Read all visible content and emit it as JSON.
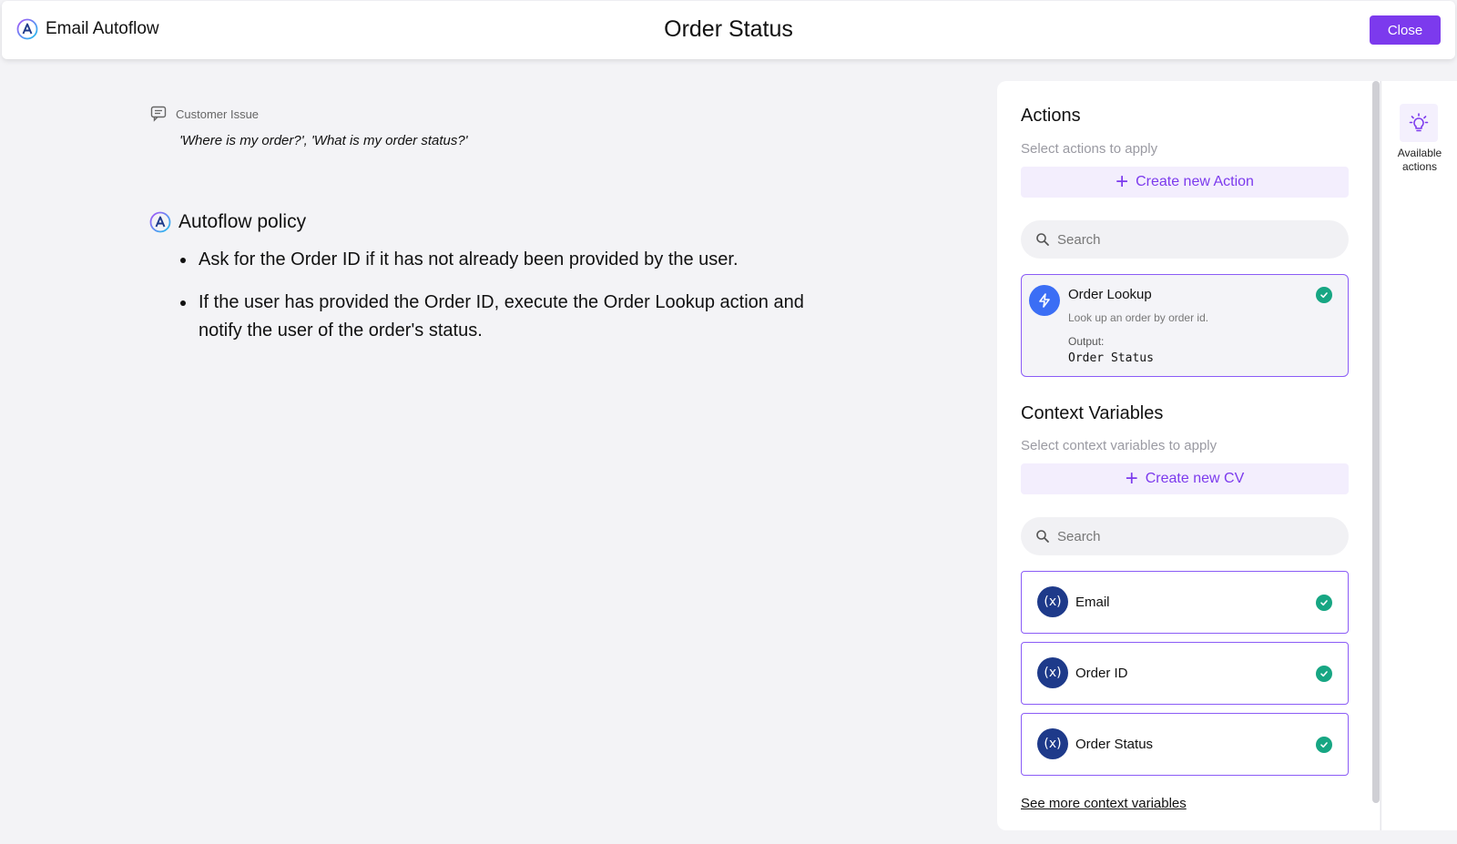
{
  "header": {
    "app_name": "Email Autoflow",
    "title": "Order Status",
    "close_label": "Close"
  },
  "issue": {
    "label": "Customer Issue",
    "text": "'Where is my order?', 'What is my order status?'"
  },
  "policy": {
    "title": "Autoflow policy",
    "items": [
      "Ask for the Order ID if it has not already been provided by the user.",
      "If the user has provided the Order ID, execute the Order Lookup action and notify the user of the order's status."
    ]
  },
  "actions": {
    "title": "Actions",
    "subtitle": "Select actions to apply",
    "create_label": "Create new Action",
    "search_placeholder": "Search",
    "items": [
      {
        "name": "Order Lookup",
        "description": "Look up an order by order id.",
        "output_label": "Output:",
        "output_value": "Order Status",
        "icon": "lightning-icon",
        "selected": true
      }
    ]
  },
  "context_variables": {
    "title": "Context Variables",
    "subtitle": "Select context variables to apply",
    "create_label": "Create new CV",
    "search_placeholder": "Search",
    "icon_glyph": "(x)",
    "items": [
      {
        "name": "Email",
        "selected": true
      },
      {
        "name": "Order ID",
        "selected": true
      },
      {
        "name": "Order Status",
        "selected": true
      }
    ],
    "see_more": "See more context variables"
  },
  "rail": {
    "label_line1": "Available",
    "label_line2": "actions",
    "icon": "lightbulb-icon"
  },
  "colors": {
    "accent": "#7c3aed",
    "success": "#17a683",
    "action_icon": "#3b6ef5",
    "cv_icon": "#1e3a8a"
  }
}
